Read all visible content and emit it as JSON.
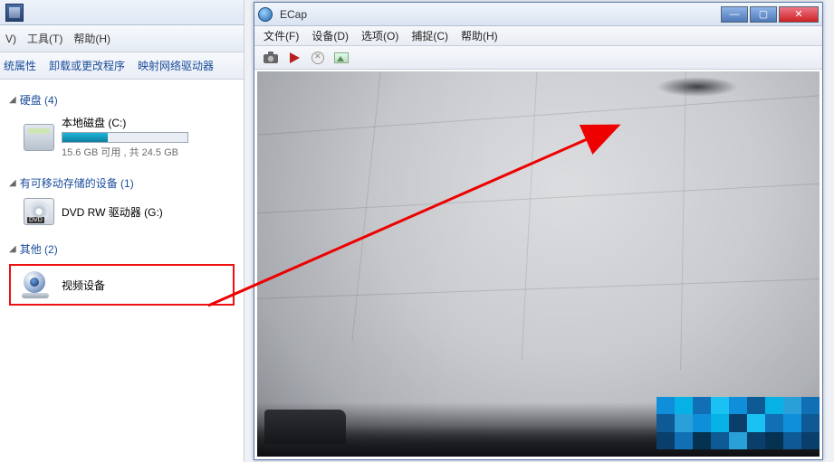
{
  "explorer": {
    "menu": {
      "view": "V)",
      "tools": "工具(T)",
      "help": "帮助(H)"
    },
    "toolbar": {
      "sys_props": "统属性",
      "uninstall": "卸载或更改程序",
      "map_drive": "映射网络驱动器"
    },
    "categories": {
      "drives_label": "硬盘 (4)",
      "removable_label": "有可移动存储的设备 (1)",
      "other_label": "其他 (2)"
    },
    "drive_c": {
      "name": "本地磁盘 (C:)",
      "capacity_text": "15.6 GB 可用 , 共 24.5 GB",
      "fill_pct": 36
    },
    "dvd": {
      "name": "DVD RW 驱动器 (G:)"
    },
    "video_device": {
      "name": "视频设备"
    }
  },
  "ecap": {
    "title": "ECap",
    "menu": {
      "file": "文件(F)",
      "device": "设备(D)",
      "options": "选项(O)",
      "capture": "捕捉(C)",
      "help": "帮助(H)"
    },
    "win_buttons": {
      "min": "—",
      "max": "▢",
      "close": "✕"
    }
  }
}
